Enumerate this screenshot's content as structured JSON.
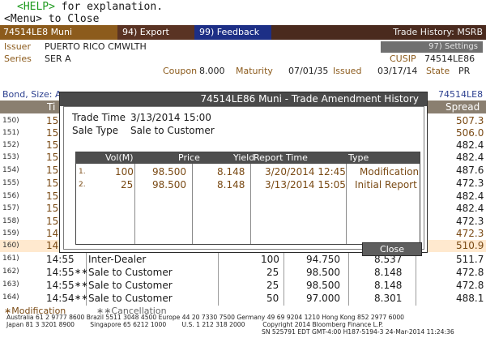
{
  "help": {
    "key": "<HELP>",
    "text": "for explanation.",
    "menu": "<Menu> to Close"
  },
  "toolbar": {
    "ticker": "74514LE8 Muni",
    "export": "94) Export",
    "feedback": "99) Feedback",
    "title": "Trade History: MSRB",
    "settings": "97) Settings"
  },
  "bond": {
    "issuer_label": "Issuer",
    "issuer": "PUERTO RICO CMWLTH",
    "series_label": "Series",
    "series": "SER A",
    "cusip_label": "CUSIP",
    "cusip": "74514LE86",
    "coupon_label": "Coupon",
    "coupon": "8.000",
    "maturity_label": "Maturity",
    "maturity": "07/01/35",
    "issued_label": "Issued",
    "issued": "03/17/14",
    "state_label": "State",
    "state": "PR"
  },
  "table_row_above": {
    "left": "Bond, Size: A",
    "right": "74514LE8"
  },
  "table_header": {
    "left": "Ti",
    "right": "Spread"
  },
  "background_rows": [
    {
      "n": "150)",
      "time": "15:",
      "spread": "507.3"
    },
    {
      "n": "151)",
      "time": "15:",
      "spread": "506.0"
    },
    {
      "n": "152)",
      "time": "15:",
      "spread": "482.4"
    },
    {
      "n": "153)",
      "time": "15:",
      "spread": "482.4"
    },
    {
      "n": "154)",
      "time": "15:",
      "spread": "487.6"
    },
    {
      "n": "155)",
      "time": "15:",
      "spread": "472.3"
    },
    {
      "n": "156)",
      "time": "15:",
      "spread": "482.4"
    },
    {
      "n": "157)",
      "time": "15:",
      "spread": "482.4"
    },
    {
      "n": "158)",
      "time": "15:",
      "spread": "472.3"
    },
    {
      "n": "159)",
      "time": "14:",
      "spread": "472.3"
    },
    {
      "n": "160)",
      "time": "14:",
      "spread": "510.9"
    }
  ],
  "bottom_rows": [
    {
      "n": "161)",
      "time": "14:55",
      "flag": "",
      "type": "Inter-Dealer",
      "size": "100",
      "price": "94.750",
      "yield": "8.537",
      "spread": "511.7"
    },
    {
      "n": "162)",
      "time": "14:55",
      "flag": "∗∗",
      "type": "Sale to Customer",
      "size": "25",
      "price": "98.500",
      "yield": "8.148",
      "spread": "472.8"
    },
    {
      "n": "163)",
      "time": "14:55",
      "flag": "∗∗",
      "type": "Sale to Customer",
      "size": "25",
      "price": "98.500",
      "yield": "8.148",
      "spread": "472.8"
    },
    {
      "n": "164)",
      "time": "14:54",
      "flag": "∗∗",
      "type": "Sale to Customer",
      "size": "50",
      "price": "97.000",
      "yield": "8.301",
      "spread": "488.1"
    }
  ],
  "modal": {
    "title": "74514LE86 Muni - Trade Amendment History",
    "trade_time_label": "Trade Time",
    "trade_time": "3/13/2014 15:00",
    "sale_type_label": "Sale Type",
    "sale_type": "Sale to Customer",
    "columns": [
      "Vol(M)",
      "Price",
      "Yield",
      "Report Time",
      "Type"
    ],
    "rows": [
      {
        "n": "1.",
        "vol": "100",
        "price": "98.500",
        "yield": "8.148",
        "report_time": "3/20/2014 12:45",
        "type": "Modification"
      },
      {
        "n": "2.",
        "vol": "25",
        "price": "98.500",
        "yield": "8.148",
        "report_time": "3/13/2014 15:05",
        "type": "Initial Report"
      }
    ],
    "close": "Close"
  },
  "legend": {
    "modification": "∗Modification",
    "cancellation": "∗∗Cancellation"
  },
  "footer": {
    "line1": "Australia 61 2 9777 8600 Brazil 5511 3048 4500 Europe 44 20 7330 7500 Germany 49 69 9204 1210 Hong Kong 852 2977 6000",
    "line2": "Japan 81 3 3201 8900        Singapore 65 6212 1000        U.S. 1 212 318 2000         Copyright 2014 Bloomberg Finance L.P.",
    "line3": "SN 525791 EDT  GMT-4:00 H187-5194-3 24-Mar-2014 11:24:36"
  }
}
